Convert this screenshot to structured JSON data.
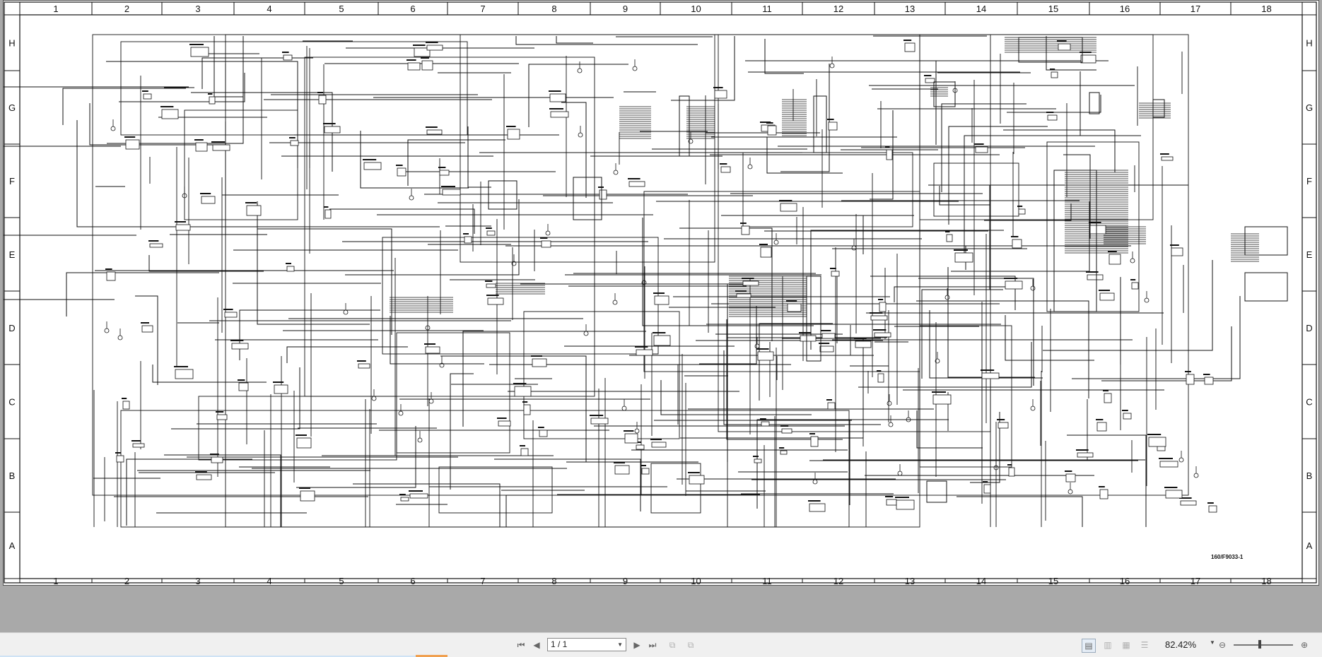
{
  "drawing": {
    "columns": [
      "1",
      "2",
      "3",
      "4",
      "5",
      "6",
      "7",
      "8",
      "9",
      "10",
      "11",
      "12",
      "13",
      "14",
      "15",
      "16",
      "17",
      "18"
    ],
    "rows": [
      "H",
      "G",
      "F",
      "E",
      "D",
      "C",
      "B",
      "A"
    ],
    "drawing_number": "160/F9033-1"
  },
  "toolbar": {
    "page_indicator": "1 / 1",
    "zoom_level": "82.42%",
    "icons": {
      "first": "first-page-icon",
      "prev": "previous-page-icon",
      "next": "next-page-icon",
      "last": "last-page-icon",
      "single": "single-page-view-icon",
      "continuous": "continuous-view-icon",
      "facing": "facing-pages-icon",
      "cover": "cover-view-icon",
      "zoom_out": "zoom-out-icon",
      "zoom_in": "zoom-in-icon"
    }
  },
  "colors": {
    "background": "#a9a9a9",
    "page": "#ffffff",
    "line": "#111111",
    "accent": "#f0a050"
  }
}
